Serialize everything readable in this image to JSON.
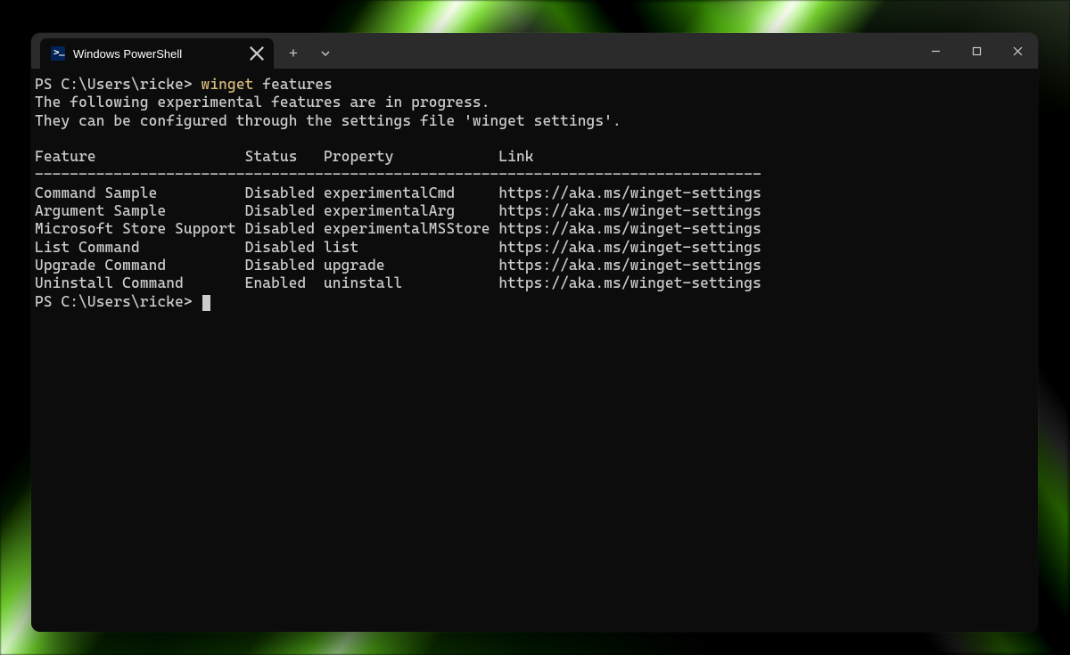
{
  "tab": {
    "title": "Windows PowerShell",
    "icon": "powershell-icon"
  },
  "prompt": "PS C:\\Users\\ricke>",
  "command": {
    "bin": "winget",
    "args": "features"
  },
  "intro_lines": [
    "The following experimental features are in progress.",
    "They can be configured through the settings file 'winget settings'."
  ],
  "columns": {
    "feature": "Feature",
    "status": "Status",
    "property": "Property",
    "link": "Link"
  },
  "col_widths": {
    "feature": 24,
    "status": 9,
    "property": 20
  },
  "rows": [
    {
      "feature": "Command Sample",
      "status": "Disabled",
      "property": "experimentalCmd",
      "link": "https://aka.ms/winget-settings"
    },
    {
      "feature": "Argument Sample",
      "status": "Disabled",
      "property": "experimentalArg",
      "link": "https://aka.ms/winget-settings"
    },
    {
      "feature": "Microsoft Store Support",
      "status": "Disabled",
      "property": "experimentalMSStore",
      "link": "https://aka.ms/winget-settings"
    },
    {
      "feature": "List Command",
      "status": "Disabled",
      "property": "list",
      "link": "https://aka.ms/winget-settings"
    },
    {
      "feature": "Upgrade Command",
      "status": "Disabled",
      "property": "upgrade",
      "link": "https://aka.ms/winget-settings"
    },
    {
      "feature": "Uninstall Command",
      "status": "Enabled",
      "property": "uninstall",
      "link": "https://aka.ms/winget-settings"
    }
  ],
  "divider_width": 83
}
